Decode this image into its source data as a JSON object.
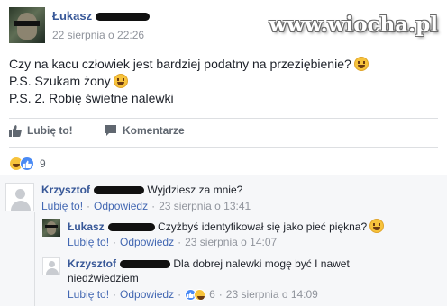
{
  "post": {
    "author": "Łukasz",
    "time": "22 sierpnia o 22:26",
    "lines": [
      "Czy na kacu człowiek jest bardziej podatny na przeziębienie?",
      "P.S. Szukam żony",
      "P.S. 2. Robię świetne nalewki"
    ]
  },
  "watermark": "www.wiocha.pl",
  "actions": {
    "like": "Lubię to!",
    "comment": "Komentarze"
  },
  "reactions": {
    "count": "9"
  },
  "comments": [
    {
      "author": "Krzysztof",
      "text": "Wyjdziesz za mnie?",
      "like": "Lubię to!",
      "reply": "Odpowiedz",
      "time": "23 sierpnia o 13:41"
    },
    {
      "author": "Łukasz",
      "text": "Czyżbyś identyfikował się jako pieć piękna?",
      "like": "Lubię to!",
      "reply": "Odpowiedz",
      "time": "23 sierpnia o 14:07"
    },
    {
      "author": "Krzysztof",
      "text_line1": "Dla dobrej nalewki mogę być I nawet",
      "text_line2": "niedźwiedziem",
      "like": "Lubię to!",
      "reply": "Odpowiedz",
      "reaction_count": "6",
      "time": "23 sierpnia o 14:09"
    }
  ],
  "colors": {
    "link": "#385898",
    "meta": "#90949c",
    "action": "#606770",
    "comments_bg": "#f6f7f9"
  }
}
